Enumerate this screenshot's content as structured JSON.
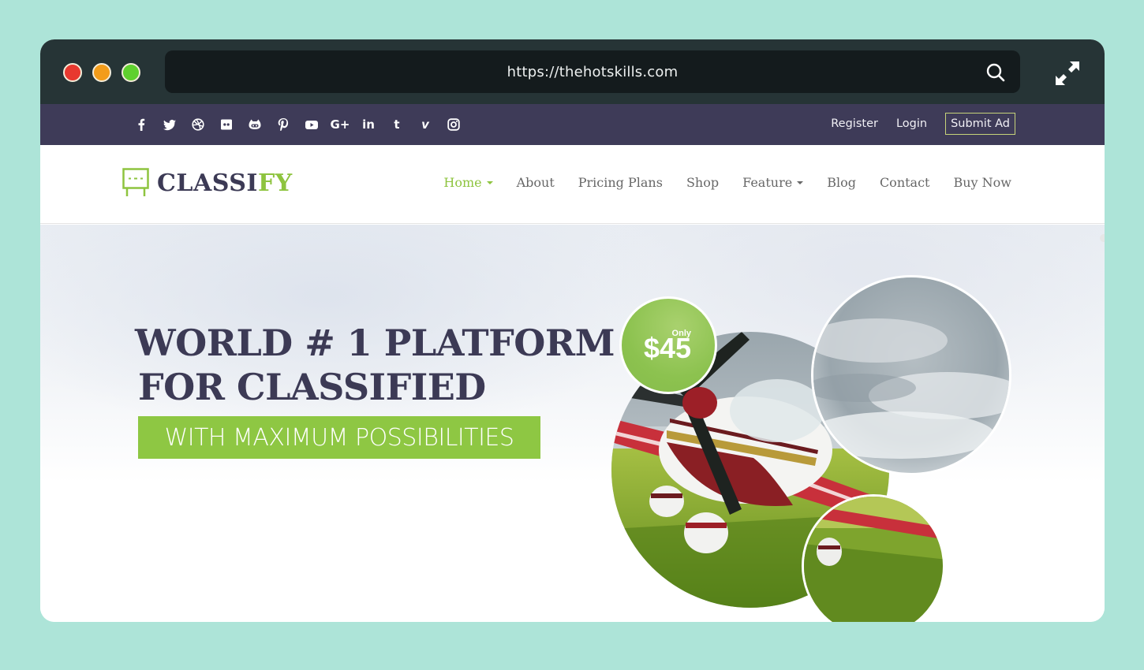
{
  "browser": {
    "url": "https://thehotskills.com",
    "traffic_lights": [
      "close",
      "minimize",
      "maximize"
    ],
    "colors": {
      "frame": "#263436",
      "urlbar": "#141b1d",
      "page_bg": "#ade4d8"
    }
  },
  "topbar": {
    "socials": [
      {
        "name": "facebook",
        "icon": "facebook-icon"
      },
      {
        "name": "twitter",
        "icon": "twitter-icon"
      },
      {
        "name": "dribbble",
        "icon": "dribbble-icon"
      },
      {
        "name": "flickr",
        "icon": "flickr-icon"
      },
      {
        "name": "github",
        "icon": "github-icon"
      },
      {
        "name": "pinterest",
        "icon": "pinterest-icon"
      },
      {
        "name": "youtube",
        "icon": "youtube-icon"
      },
      {
        "name": "google-plus",
        "icon": "google-plus-icon",
        "text": "G+"
      },
      {
        "name": "linkedin",
        "icon": "linkedin-icon",
        "text": "in"
      },
      {
        "name": "tumblr",
        "icon": "tumblr-icon",
        "text": "t"
      },
      {
        "name": "vimeo",
        "icon": "vimeo-icon",
        "text": "v"
      },
      {
        "name": "instagram",
        "icon": "instagram-icon"
      }
    ],
    "links": {
      "register": "Register",
      "login": "Login",
      "submit_ad": "Submit Ad"
    },
    "colors": {
      "bg": "#3e3b58",
      "submit_border": "#c6d37a"
    }
  },
  "navbar": {
    "logo": {
      "main": "CLASSI",
      "accent": "FY"
    },
    "menu": [
      {
        "label": "Home",
        "active": true,
        "dropdown": true
      },
      {
        "label": "About"
      },
      {
        "label": "Pricing Plans"
      },
      {
        "label": "Shop"
      },
      {
        "label": "Feature",
        "dropdown": true
      },
      {
        "label": "Blog"
      },
      {
        "label": "Contact"
      },
      {
        "label": "Buy Now"
      }
    ],
    "colors": {
      "accent": "#8ec43f",
      "text": "#676767",
      "logo": "#3c3a55"
    }
  },
  "hero": {
    "headline_line1": "WORLD # 1 PLATFORM",
    "headline_line2": "FOR CLASSIFIED",
    "subheadline": "WITH MAXIMUM POSSIBILITIES",
    "price_badge": {
      "prefix": "Only",
      "price": "$45"
    },
    "images": [
      "airplane-on-grass",
      "cloudy-sky",
      "grass-field"
    ],
    "colors": {
      "headline": "#3c3a55",
      "banner": "#8ec743"
    }
  }
}
